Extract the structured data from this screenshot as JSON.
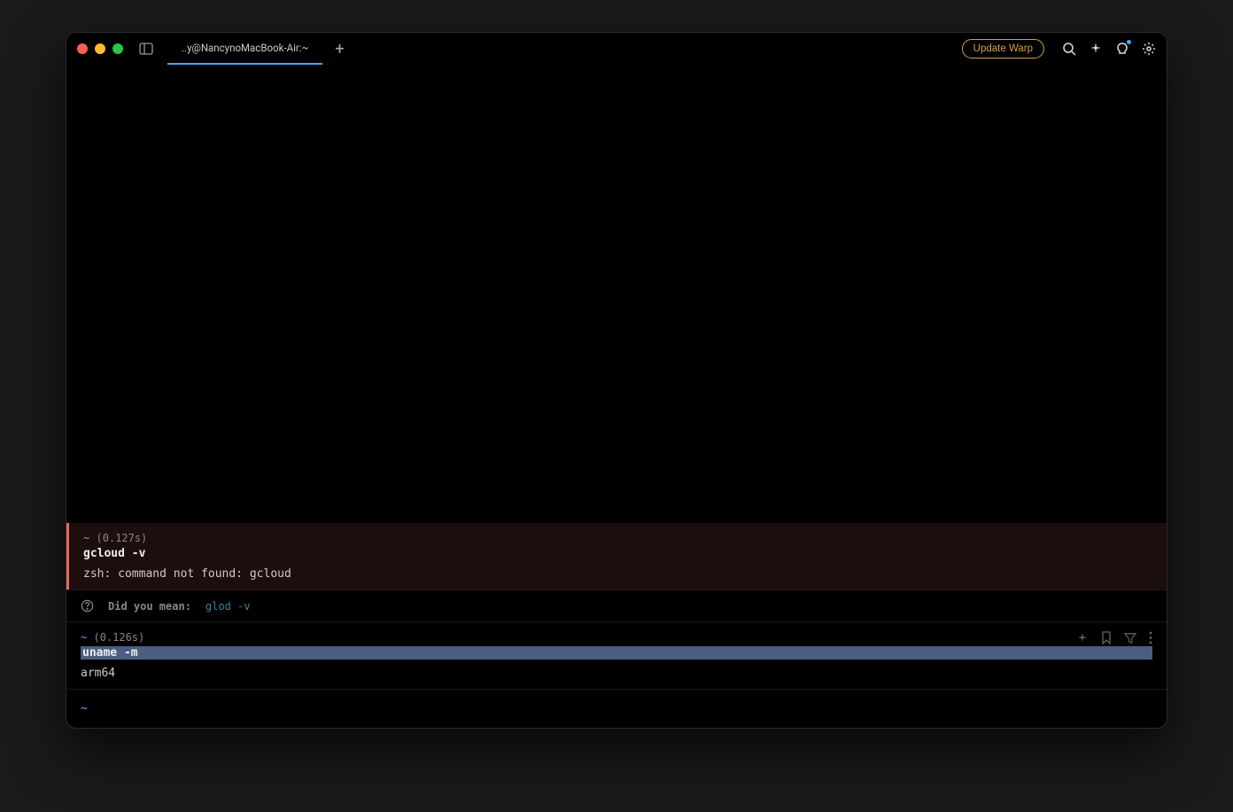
{
  "titlebar": {
    "tab_title": "..y@NancynoMacBook-Air:~",
    "update_button": "Update Warp",
    "new_tab_symbol": "+"
  },
  "blocks": {
    "error": {
      "prompt_dir": "~",
      "duration": "(0.127s)",
      "command": "gcloud -v",
      "output": "zsh: command not found: gcloud"
    },
    "suggestion": {
      "label": "Did you mean:",
      "cmd": "glod -v"
    },
    "success": {
      "prompt_dir": "~",
      "duration": "(0.126s)",
      "command": "uname -m",
      "output": "arm64"
    }
  },
  "prompt": {
    "dir": "~"
  },
  "colors": {
    "accent": "#3da9fc",
    "error_border": "#e86a5c",
    "warn_text": "#d4a043",
    "prompt_purple": "#c77dff"
  }
}
